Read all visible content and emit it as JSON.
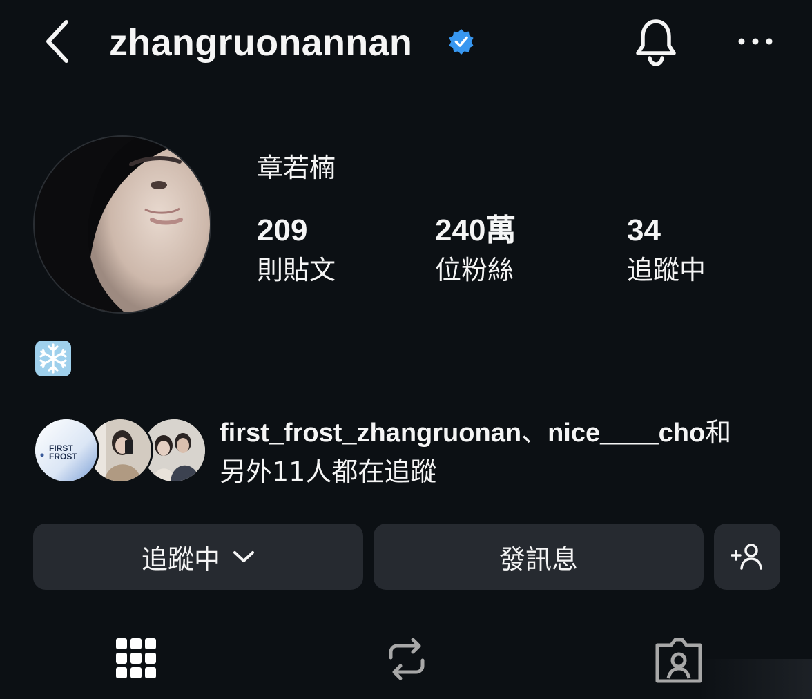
{
  "header": {
    "username": "zhangruonannan",
    "verified": true,
    "back_icon": "chevron-left-icon",
    "notification_icon": "bell-icon",
    "more_icon": "more-horizontal-icon"
  },
  "profile": {
    "display_name": "章若楠",
    "stats": {
      "posts": {
        "value": "209",
        "label": "則貼文"
      },
      "followers": {
        "value": "240萬",
        "label": "位粉絲"
      },
      "following": {
        "value": "34",
        "label": "追蹤中"
      }
    },
    "bio_emoji": "snowflake-icon"
  },
  "followed_by": {
    "user1": "first_frost_zhangruonan",
    "separator": "、",
    "user2": "nice____cho",
    "and_text": "和",
    "others_text": "另外11人都在追蹤",
    "avatar1_text": [
      "FIRST",
      "FROST"
    ]
  },
  "actions": {
    "following_label": "追蹤中",
    "message_label": "發訊息",
    "suggest_icon": "add-person-icon"
  },
  "tabs": [
    {
      "name": "grid",
      "icon": "grid-icon"
    },
    {
      "name": "reposts",
      "icon": "repost-icon"
    },
    {
      "name": "tagged",
      "icon": "tagged-icon"
    }
  ],
  "colors": {
    "background": "#0c1014",
    "button_bg": "#262a30",
    "verified_blue": "#3897f0",
    "text": "#f5f5f5"
  }
}
